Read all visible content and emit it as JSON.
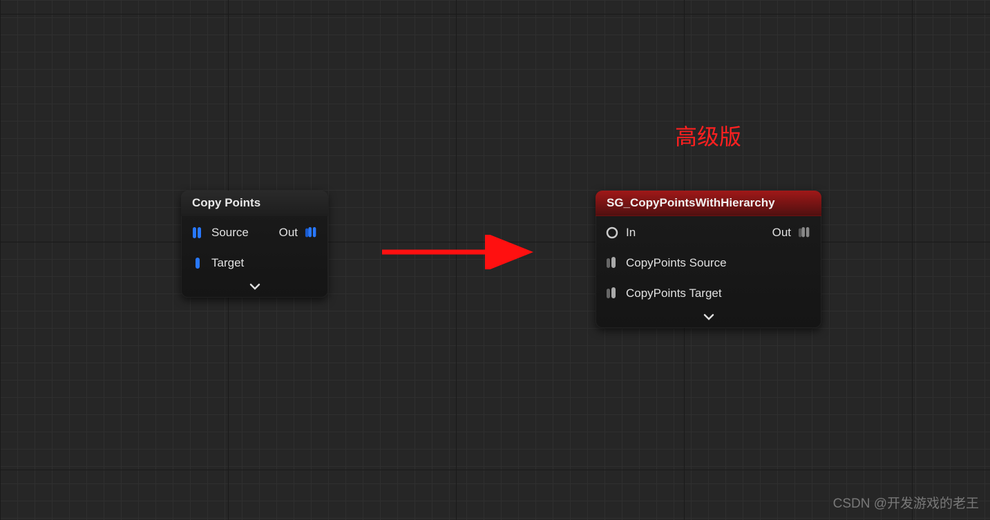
{
  "annotation": {
    "label": "高级版"
  },
  "node1": {
    "title": "Copy Points",
    "pins": {
      "source": "Source",
      "target": "Target",
      "out": "Out"
    }
  },
  "node2": {
    "title": "SG_CopyPointsWithHierarchy",
    "pins": {
      "in": "In",
      "copySource": "CopyPoints Source",
      "copyTarget": "CopyPoints Target",
      "out": "Out"
    }
  },
  "watermark": "CSDN @开发游戏的老王"
}
